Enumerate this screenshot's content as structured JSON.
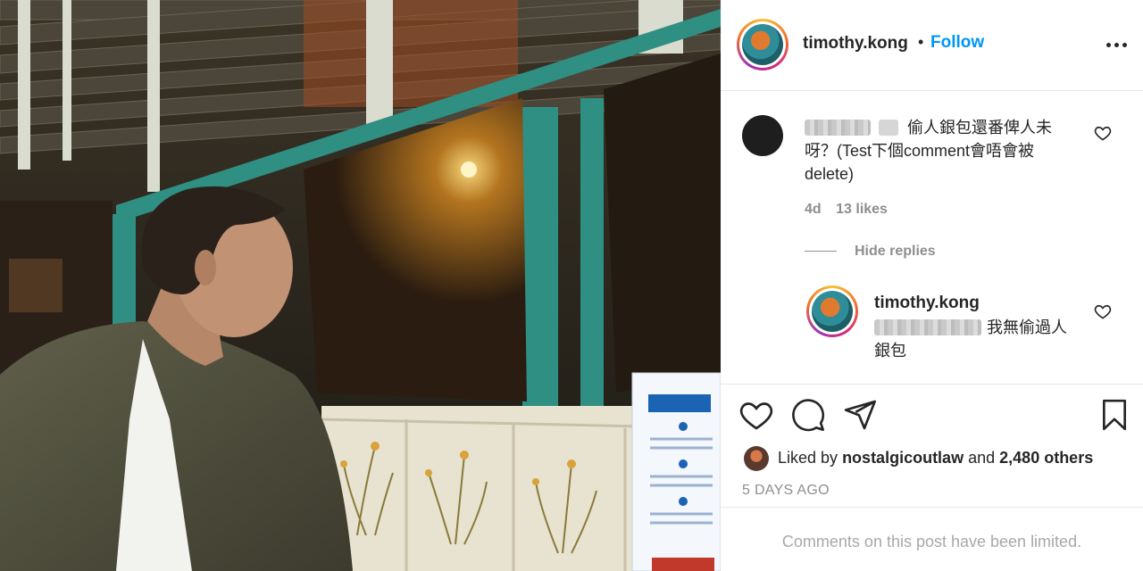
{
  "post": {
    "username": "timothy.kong",
    "separator": "•",
    "follow_label": "Follow",
    "more_icon": "more-options-icon"
  },
  "comment": {
    "author_blurred": true,
    "text": "偷人銀包還番俾人未呀？(Test下個comment會唔會被delete)",
    "age": "4d",
    "likes": "13 likes",
    "hide_replies": "Hide replies"
  },
  "reply": {
    "username": "timothy.kong",
    "mention_blurred": true,
    "text": "我無偷過人銀包"
  },
  "actions": {
    "like_icon": "heart-icon",
    "comment_icon": "comment-icon",
    "share_icon": "send-icon",
    "save_icon": "bookmark-icon"
  },
  "likes": {
    "prefix": "Liked by",
    "user": "nostalgicoutlaw",
    "joiner": "and",
    "others": "2,480 others"
  },
  "timestamp": "5 DAYS AGO",
  "footer": {
    "limited": "Comments on this post have been limited."
  },
  "colors": {
    "link": "#0095f6",
    "muted": "#8e8e8e",
    "text": "#262626",
    "divider": "#e6e6e6"
  }
}
